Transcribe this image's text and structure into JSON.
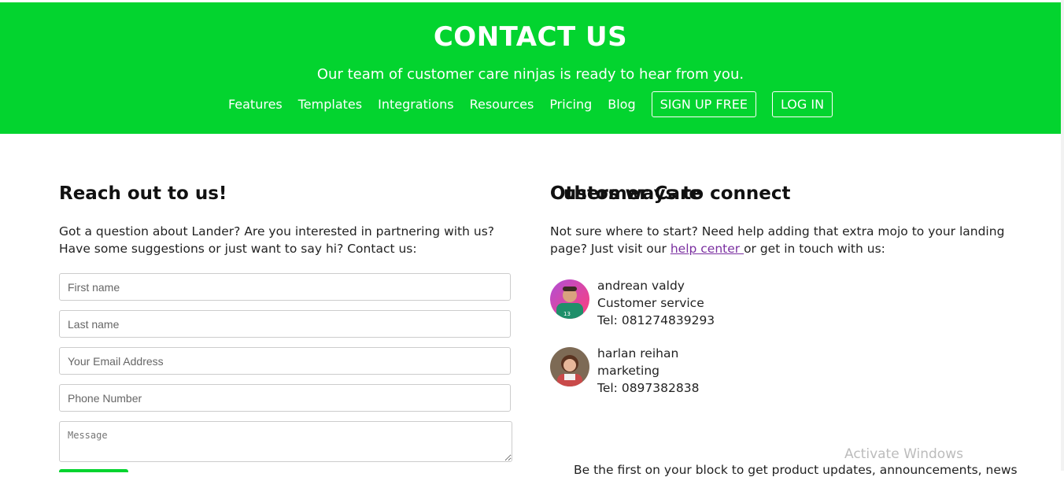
{
  "hero": {
    "title": "CONTACT US",
    "subtitle": "Our team of customer care ninjas is ready to hear from you.",
    "nav": [
      "Features",
      "Templates",
      "Integrations",
      "Resources",
      "Pricing",
      "Blog"
    ],
    "signup_label": "SIGN UP FREE",
    "login_label": "LOG IN"
  },
  "left": {
    "heading": "Reach out to us!",
    "intro": "Got a question about Lander? Are you interested in partnering with us? Have some suggestions or just want to say hi? Contact us:",
    "fields": {
      "first_name": "First name",
      "last_name": "Last name",
      "email": "Your Email Address",
      "phone": "Phone Number",
      "message": "Message"
    }
  },
  "right": {
    "heading": "Customer Care",
    "intro_before": "Not sure where to start? Need help adding that extra mojo to your landing page? Just visit our ",
    "help_link": "help center ",
    "intro_after": "or get in touch with us:",
    "contacts": [
      {
        "name": "andrean valdy",
        "role": "Customer service",
        "tel": "Tel: 081274839293"
      },
      {
        "name": "harlan reihan",
        "role": "marketing",
        "tel": "Tel: 0897382838"
      }
    ],
    "connect_heading": "Others ways to connect",
    "connect_text": "Be the first on your block to get product updates, announcements, news"
  },
  "os": {
    "watermark": "Activate Windows"
  },
  "colors": {
    "brand_green": "#03d42f",
    "link_purple": "#7a2fa0"
  }
}
